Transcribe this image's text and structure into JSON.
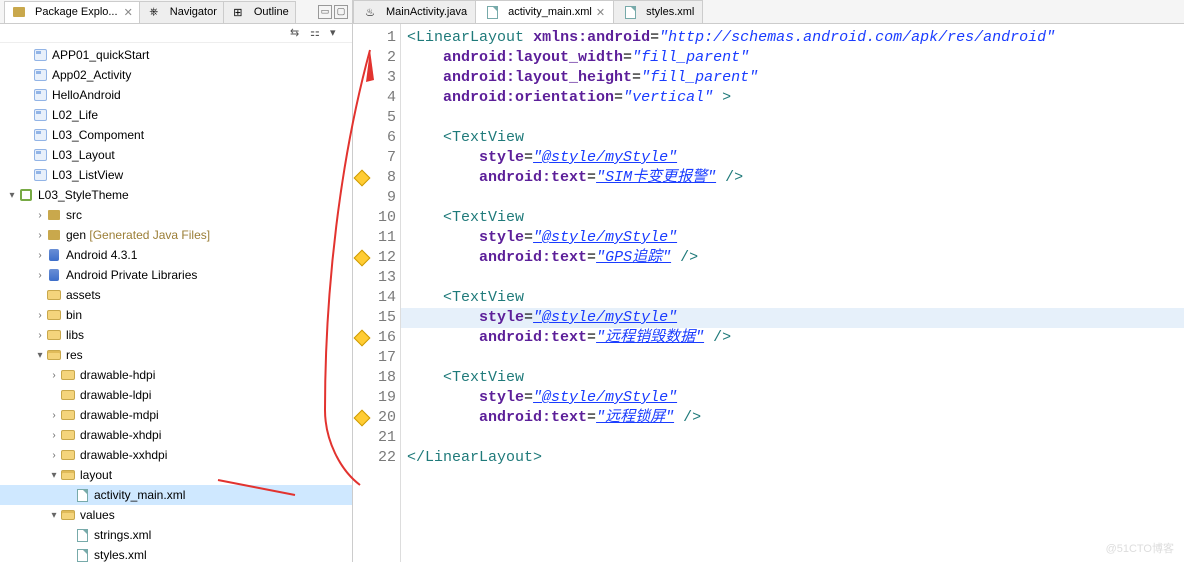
{
  "side_tabs": {
    "items": [
      {
        "label": "Package Explo..."
      },
      {
        "label": "Navigator"
      },
      {
        "label": "Outline"
      }
    ]
  },
  "mini_toolbar": {
    "a": "⇆",
    "b": "⚏",
    "c": "▾"
  },
  "projects": [
    {
      "name": "APP01_quickStart"
    },
    {
      "name": "App02_Activity"
    },
    {
      "name": "HelloAndroid"
    },
    {
      "name": "L02_Life"
    },
    {
      "name": "L03_Compoment"
    },
    {
      "name": "L03_Layout"
    },
    {
      "name": "L03_ListView"
    }
  ],
  "active_project": {
    "name": "L03_StyleTheme",
    "children": {
      "src": "src",
      "gen_label": "gen",
      "gen_note": "[Generated Java Files]",
      "android": "Android 4.3.1",
      "priv": "Android Private Libraries",
      "assets": "assets",
      "bin": "bin",
      "libs": "libs",
      "res": "res",
      "drawable_hdpi": "drawable-hdpi",
      "drawable_ldpi": "drawable-ldpi",
      "drawable_mdpi": "drawable-mdpi",
      "drawable_xhdpi": "drawable-xhdpi",
      "drawable_xxhdpi": "drawable-xxhdpi",
      "layout": "layout",
      "activity_main": "activity_main.xml",
      "values": "values",
      "strings": "strings.xml",
      "styles": "styles.xml"
    }
  },
  "editor_tabs": [
    {
      "label": "MainActivity.java",
      "icon": "java"
    },
    {
      "label": "activity_main.xml",
      "icon": "xml",
      "active": true
    },
    {
      "label": "styles.xml",
      "icon": "xml"
    }
  ],
  "line_numbers": [
    1,
    2,
    3,
    4,
    5,
    6,
    7,
    8,
    9,
    10,
    11,
    12,
    13,
    14,
    15,
    16,
    17,
    18,
    19,
    20,
    21,
    22
  ],
  "markers": {
    "8": "warn",
    "12": "warn",
    "16": "warn",
    "20": "warn"
  },
  "highlighted_lines": [
    15
  ],
  "xml": {
    "root_open": "<LinearLayout",
    "ns_attr": "xmlns:android",
    "ns_val": "\"http://schemas.android.com/apk/res/android\"",
    "width_attr": "android:layout_width",
    "width_val": "\"fill_parent\"",
    "height_attr": "android:layout_height",
    "height_val": "\"fill_parent\"",
    "orient_attr": "android:orientation",
    "orient_val": "\"vertical\"",
    "close_sym": ">",
    "root_close": "</LinearLayout>",
    "tv_open": "<TextView",
    "style_attr": "style",
    "style_val": "\"@style/myStyle\"",
    "text_attr": "android:text",
    "self_close": "/>",
    "t1": "\"SIM卡变更报警\"",
    "t2": "\"GPS追踪\"",
    "t3": "\"远程销毁数据\"",
    "t4": "\"远程锁屏\""
  },
  "watermark": "@51CTO博客"
}
